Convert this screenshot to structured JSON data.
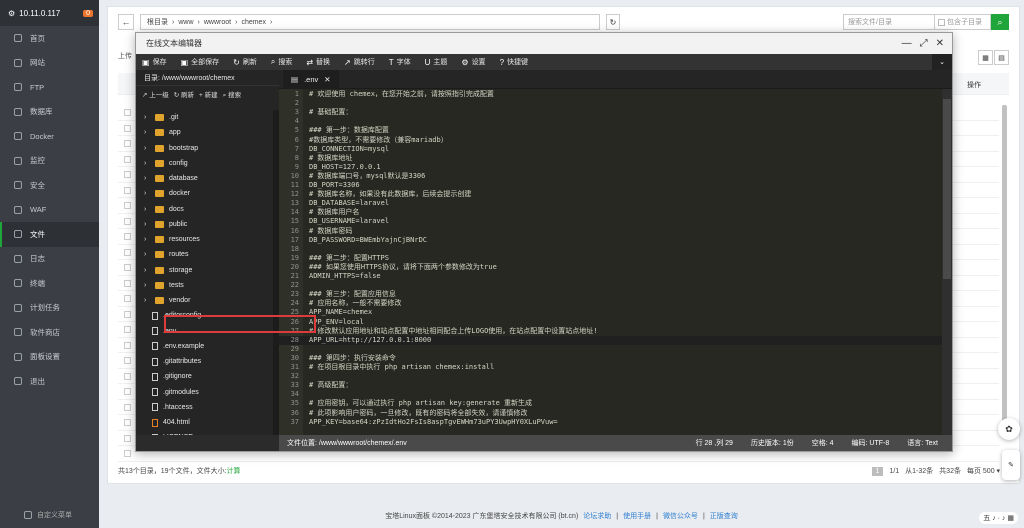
{
  "sidebar": {
    "host": "10.11.0.117",
    "badge": "0",
    "items": [
      {
        "label": "首页",
        "icon": "home-icon"
      },
      {
        "label": "网站",
        "icon": "globe-icon"
      },
      {
        "label": "FTP",
        "icon": "ftp-icon"
      },
      {
        "label": "数据库",
        "icon": "database-icon"
      },
      {
        "label": "Docker",
        "icon": "docker-icon"
      },
      {
        "label": "监控",
        "icon": "monitor-icon"
      },
      {
        "label": "安全",
        "icon": "shield-icon"
      },
      {
        "label": "WAF",
        "icon": "waf-icon"
      },
      {
        "label": "文件",
        "icon": "folder-icon",
        "active": true
      },
      {
        "label": "日志",
        "icon": "log-icon"
      },
      {
        "label": "终端",
        "icon": "terminal-icon"
      },
      {
        "label": "计划任务",
        "icon": "clock-icon"
      },
      {
        "label": "软件商店",
        "icon": "store-icon"
      },
      {
        "label": "面板设置",
        "icon": "gear-icon"
      },
      {
        "label": "退出",
        "icon": "logout-icon"
      }
    ],
    "footer": "自定义菜单"
  },
  "filemanager": {
    "back": "←",
    "breadcrumb": [
      "根目录",
      "www",
      "wwwroot",
      "chemex"
    ],
    "search_placeholder": "搜索文件/目录",
    "include_sub": "包含子目录",
    "col_left": "上传",
    "col_action": "操作",
    "footer_text": "共13个目录，19个文件，文件大小:",
    "footer_calc": "计算",
    "pager": {
      "current": "1",
      "total_pages": "1/1",
      "range": "从1-32条",
      "count": "共32条",
      "per_page": "每页 500 ▾ 条"
    }
  },
  "editor": {
    "title": "在线文本编辑器",
    "toolbar": [
      "保存",
      "全部保存",
      "刷新",
      "搜索",
      "替换",
      "跳转行",
      "字体",
      "主题",
      "设置",
      "快捷键"
    ],
    "dir_label": "目录: /www/wwwroot/chemex",
    "tree_tools": [
      "上一级",
      "刷新",
      "新建",
      "搜索"
    ],
    "tree": [
      {
        "name": ".git",
        "type": "dir"
      },
      {
        "name": "app",
        "type": "dir"
      },
      {
        "name": "bootstrap",
        "type": "dir"
      },
      {
        "name": "config",
        "type": "dir"
      },
      {
        "name": "database",
        "type": "dir"
      },
      {
        "name": "docker",
        "type": "dir"
      },
      {
        "name": "docs",
        "type": "dir"
      },
      {
        "name": "public",
        "type": "dir"
      },
      {
        "name": "resources",
        "type": "dir"
      },
      {
        "name": "routes",
        "type": "dir"
      },
      {
        "name": "storage",
        "type": "dir"
      },
      {
        "name": "tests",
        "type": "dir"
      },
      {
        "name": "vendor",
        "type": "dir"
      },
      {
        "name": ".editorconfig",
        "type": "file"
      },
      {
        "name": ".env",
        "type": "file"
      },
      {
        "name": ".env.example",
        "type": "file"
      },
      {
        "name": ".gitattributes",
        "type": "file"
      },
      {
        "name": ".gitignore",
        "type": "file"
      },
      {
        "name": ".gitmodules",
        "type": "file"
      },
      {
        "name": ".htaccess",
        "type": "file"
      },
      {
        "name": "404.html",
        "type": "html"
      },
      {
        "name": "LICENSE",
        "type": "file"
      }
    ],
    "tab_name": ".env",
    "lines": [
      "# 欢迎使用 chemex，在您开始之前，请按照指引完成配置",
      "",
      "# 基础配置：",
      "",
      "### 第一步：数据库配置",
      "#数据库类型，不需要修改（兼容mariadb）",
      "DB_CONNECTION=mysql",
      "# 数据库地址",
      "DB_HOST=127.0.0.1",
      "# 数据库端口号，mysql默认是3306",
      "DB_PORT=3306",
      "# 数据库名称，如果没有此数据库，后续会提示创建",
      "DB_DATABASE=laravel",
      "# 数据库用户名",
      "DB_USERNAME=laravel",
      "# 数据库密码",
      "DB_PASSWORD=BWEmbYajnCjBNrDC",
      "",
      "### 第二步：配置HTTPS",
      "### 如果您使用HTTPS协议，请将下面两个参数修改为true",
      "ADMIN_HTTPS=false",
      "",
      "### 第三步：配置应用信息",
      "# 应用名称，一般不需要修改",
      "APP_NAME=chemex",
      "APP_ENV=local",
      "# 修改默认应用地址和站点配置中地址相同配合上传LOGO使用，在站点配置中设置站点地址!",
      "APP_URL=http://127.0.0.1:8000",
      "",
      "### 第四步：执行安装命令",
      "# 在项目根目录中执行 php artisan chemex:install",
      "",
      "# 高级配置：",
      "",
      "# 应用密钥，可以通过执行 php artisan key:generate 重新生成",
      "# 此项影响用户密码，一旦修改，既有的密码将全部失效，请谨慎修改",
      "APP_KEY=base64:zPzIdtHo2FsIs8aspTgvEWHm73uPY3UwpHY0XLuPVuw="
    ],
    "status": {
      "path": "文件位置: /www/wwwroot/chemex/.env",
      "pos": "行 28 ,列 29",
      "history": "历史版本: 1份",
      "indent": "空格: 4",
      "encoding": "编码: UTF-8",
      "lang": "语言: Text"
    }
  },
  "page_footer": {
    "copyright": "宝塔Linux面板 ©2014-2023 广东堡塔安全技术有限公司 (bt.cn)",
    "links": [
      "论坛求助",
      "使用手册",
      "微信公众号",
      "正版查询"
    ]
  },
  "badge_logo": "五 ♪ · ♪ ▦"
}
